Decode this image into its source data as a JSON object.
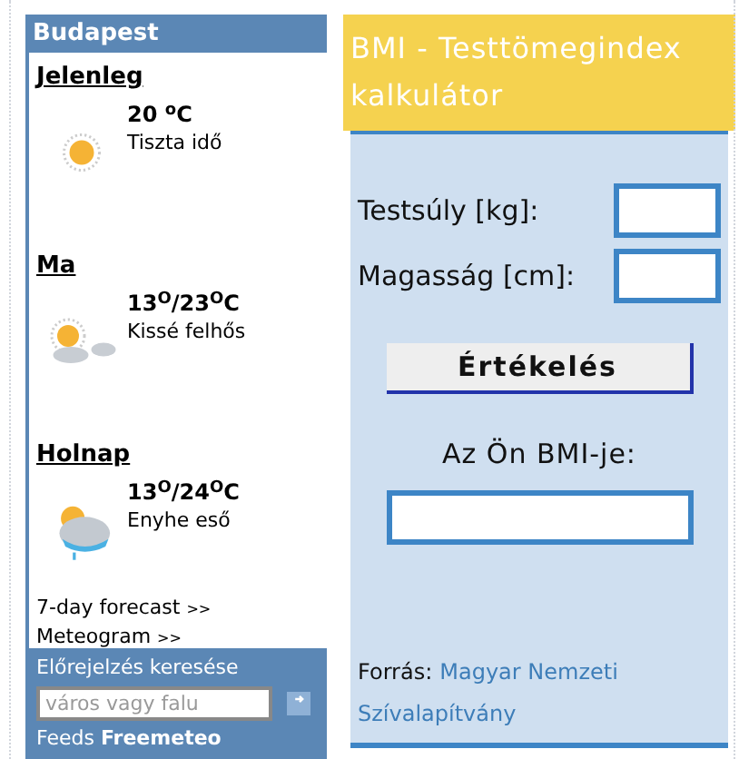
{
  "weather": {
    "city": "Budapest",
    "days": [
      {
        "label": "Jelenleg",
        "temp": "20 $^{o}$C",
        "desc": "Tiszta idő",
        "kind": "sunny"
      },
      {
        "label": "Ma",
        "temp": "13$^{O}$/23$^{O}$C",
        "desc": "Kissé felhős",
        "kind": "cloudy"
      },
      {
        "label": "Holnap",
        "temp": "13$^{O}$/24$^{O}$C",
        "desc": "Enyhe eső",
        "kind": "rain"
      }
    ],
    "links": [
      {
        "text": "7-day forecast",
        "arrow": ">>"
      },
      {
        "text": "Meteogram",
        "arrow": ">>"
      }
    ],
    "search": {
      "title": "Előrejelzés keresése",
      "placeholder": "város vagy falu"
    },
    "feeds": "Feeds **Freemeteo**"
  },
  "bmi": {
    "title": "BMI - Testtömegindex kalkulátor",
    "fields": [
      {
        "label": "Testsúly [kg]:"
      },
      {
        "label": "Magasság [cm]:"
      }
    ],
    "button": "Értékelés",
    "result_label": "Az Ön BMI-je:",
    "source_label": "Forrás:",
    "source_link_lines": [
      "Magyar Nemzeti",
      "Szívalapítvány"
    ]
  }
}
